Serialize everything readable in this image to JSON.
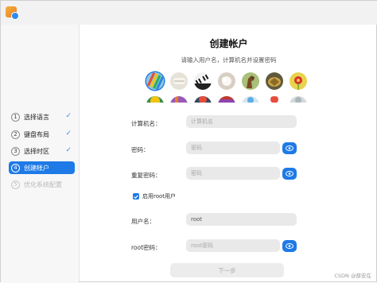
{
  "sidebar": {
    "steps": [
      {
        "num": "1",
        "label": "选择语言"
      },
      {
        "num": "2",
        "label": "键盘布局"
      },
      {
        "num": "3",
        "label": "选择时区"
      },
      {
        "num": "4",
        "label": "创建帐户"
      },
      {
        "num": "5",
        "label": "优化系统配置"
      }
    ]
  },
  "main": {
    "title": "创建帐户",
    "subtitle": "请输入用户名，计算机名并设置密码",
    "avatars": [
      "colored-pencils-avatar",
      "paper-roll-avatar",
      "piano-keys-avatar",
      "cotton-ball-avatar",
      "horse-avatar",
      "turtle-avatar",
      "flower-avatar",
      "avatar-8",
      "avatar-9",
      "avatar-10",
      "avatar-11",
      "avatar-12",
      "avatar-13",
      "avatar-14"
    ],
    "form": {
      "computer_name_label": "计算机名：",
      "computer_name_placeholder": "计算机名",
      "password_label": "密码：",
      "password_placeholder": "密码",
      "repeat_password_label": "重复密码：",
      "repeat_password_placeholder": "密码",
      "enable_root_label": "启用root用户",
      "username_label": "用户名：",
      "username_value": "root",
      "root_password_label": "root密码：",
      "root_password_placeholder": "root密码"
    },
    "next_button": "下一步"
  },
  "watermark": "CSDN @薛安在",
  "colors": {
    "accent": "#1e7ae6",
    "sidebar_bg": "#f7f7f7",
    "input_bg": "#e9e9e9"
  }
}
